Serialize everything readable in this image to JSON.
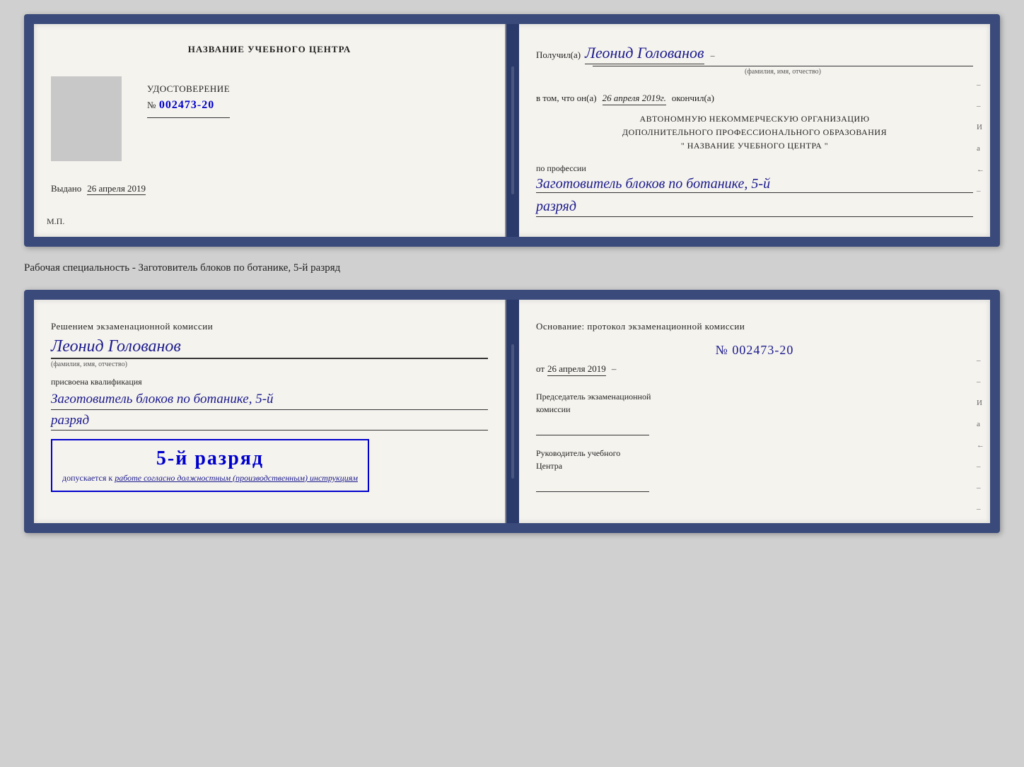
{
  "page": {
    "background_color": "#d0d0d0"
  },
  "top_doc": {
    "left": {
      "title": "НАЗВАНИЕ УЧЕБНОГО ЦЕНТРА",
      "cert_label": "УДОСТОВЕРЕНИЕ",
      "cert_number_prefix": "№",
      "cert_number": "002473-20",
      "issued_label": "Выдано",
      "issued_date": "26 апреля 2019",
      "mp_label": "М.П."
    },
    "right": {
      "received_prefix": "Получил(а)",
      "recipient_name": "Леонид Голованов",
      "fio_label": "(фамилия, имя, отчество)",
      "context_text": "в том, что он(а)",
      "date_field": "26 апреля 2019г.",
      "finished_label": "окончил(а)",
      "org_line1": "АВТОНОМНУЮ НЕКОММЕРЧЕСКУЮ ОРГАНИЗАЦИЮ",
      "org_line2": "ДОПОЛНИТЕЛЬНОГО ПРОФЕССИОНАЛЬНОГО ОБРАЗОВАНИЯ",
      "org_line3": "\"   НАЗВАНИЕ УЧЕБНОГО ЦЕНТРА   \"",
      "profession_label": "по профессии",
      "profession_name": "Заготовитель блоков по ботанике, 5-й",
      "razryad": "разряд"
    }
  },
  "between": {
    "text": "Рабочая специальность - Заготовитель блоков по ботанике, 5-й разряд"
  },
  "bottom_doc": {
    "left": {
      "decision_text": "Решением экзаменационной комиссии",
      "person_name": "Леонид Голованов",
      "fio_label": "(фамилия, имя, отчество)",
      "assigned_label": "присвоена квалификация",
      "qualification_name": "Заготовитель блоков по ботанике, 5-й",
      "razryad": "разряд",
      "stamp_rank": "5-й разряд",
      "admit_prefix": "допускается к",
      "admit_text_italic": "работе согласно должностным (производственным) инструкциям"
    },
    "right": {
      "osnov_text": "Основание: протокол экзаменационной комиссии",
      "protocol_number": "№  002473-20",
      "ot_prefix": "от",
      "protocol_date": "26 апреля 2019",
      "chairman_label_line1": "Председатель экзаменационной",
      "chairman_label_line2": "комиссии",
      "head_label_line1": "Руководитель учебного",
      "head_label_line2": "Центра"
    }
  },
  "edge_deco": {
    "items": [
      "И",
      "а",
      "←",
      "–",
      "–",
      "–",
      "–",
      "–"
    ]
  }
}
